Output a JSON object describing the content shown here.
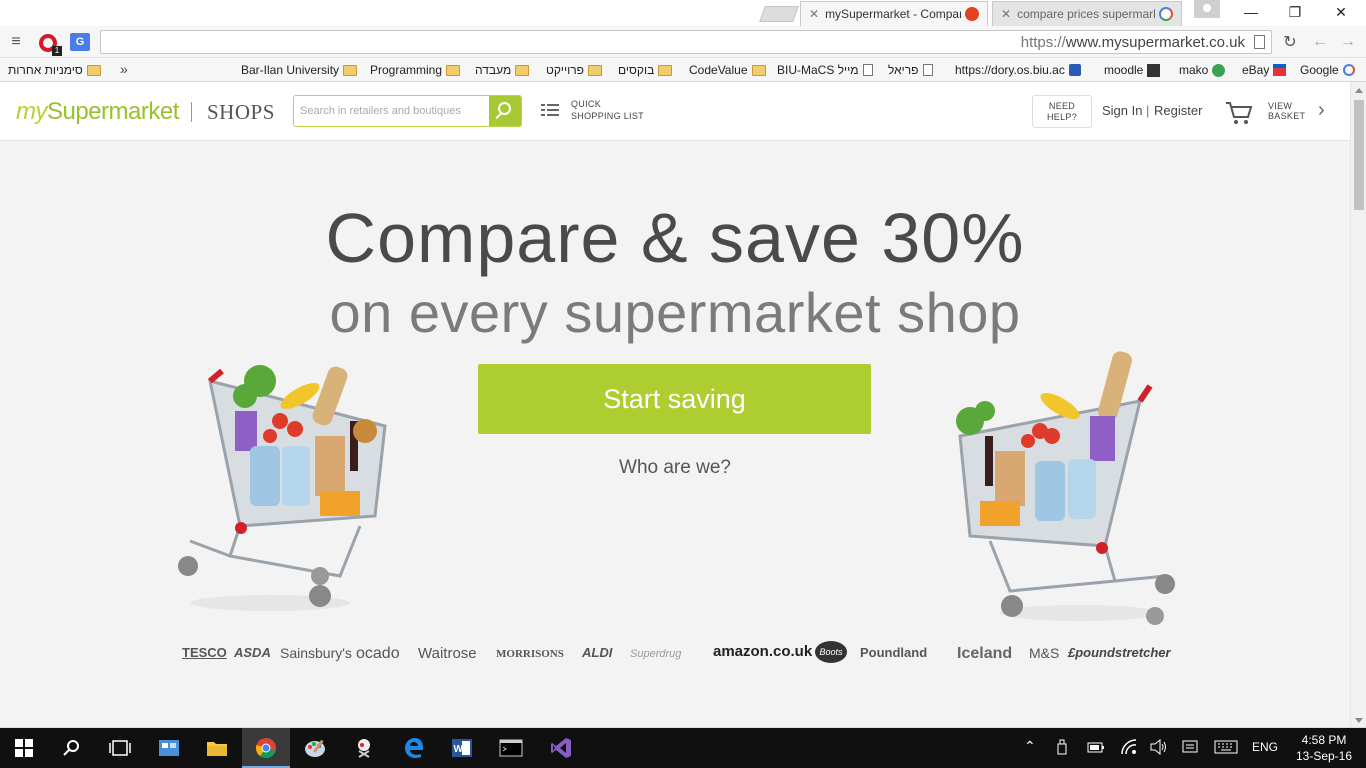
{
  "browser": {
    "tabs": [
      {
        "title": "mySupermarket - Compar",
        "active": true
      },
      {
        "title": "compare prices supermark",
        "active": false
      }
    ],
    "window_controls": {
      "minimize": "—",
      "maximize": "❐",
      "close": "✕"
    },
    "url_scheme": "https://",
    "url_host": "www.mysupermarket.co.uk",
    "extension_opera_badge": "1",
    "extension_translate_label": "G"
  },
  "bookmarks": [
    {
      "label": "סימניות אחרות",
      "type": "folder"
    },
    {
      "label": "Bar-Ilan University",
      "type": "folder"
    },
    {
      "label": "Programming",
      "type": "folder"
    },
    {
      "label": "מעבדה",
      "type": "folder"
    },
    {
      "label": "פרוייקט",
      "type": "folder"
    },
    {
      "label": "בוקסים",
      "type": "folder"
    },
    {
      "label": "CodeValue",
      "type": "folder"
    },
    {
      "label": "BIU-MaCS מייל",
      "type": "page"
    },
    {
      "label": "פריאל",
      "type": "page"
    },
    {
      "label": "https://dory.os.biu.ac",
      "type": "site"
    },
    {
      "label": "moodle",
      "type": "site"
    },
    {
      "label": "mako",
      "type": "site"
    },
    {
      "label": "eBay",
      "type": "site"
    },
    {
      "label": "Google",
      "type": "site"
    }
  ],
  "header": {
    "logo_my": "my",
    "logo_rest": "Supermarket",
    "shops": "SHOPS",
    "search_placeholder": "Search in retailers and boutiques",
    "quick_list_line1": "QUICK",
    "quick_list_line2": "SHOPPING LIST",
    "need_help_line1": "NEED",
    "need_help_line2": "HELP?",
    "sign_in": "Sign In",
    "separator": "|",
    "register": "Register",
    "view_basket_line1": "VIEW",
    "view_basket_line2": "BASKET"
  },
  "hero": {
    "headline": "Compare & save 30%",
    "subline": "on every supermarket shop",
    "cta": "Start saving",
    "who_link": "Who are we?"
  },
  "retailers": [
    "TESCO",
    "ASDA",
    "Sainsbury's",
    "ocado",
    "Waitrose",
    "MORRISONS",
    "ALDI",
    "Superdrug",
    "amazon.co.uk",
    "Boots",
    "Poundland",
    "Iceland",
    "M&S",
    "£poundstretcher"
  ],
  "taskbar": {
    "language": "ENG",
    "time": "4:58 PM",
    "date": "13-Sep-16"
  },
  "colors": {
    "brand_green": "#aecd31",
    "logo_green": "#9bc02a",
    "hero_bg": "#f3f3f3"
  }
}
